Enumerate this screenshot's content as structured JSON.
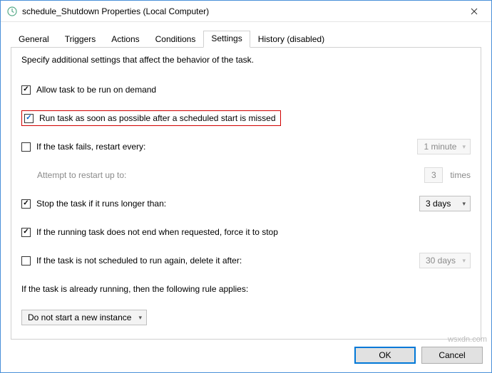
{
  "window": {
    "title": "schedule_Shutdown Properties (Local Computer)"
  },
  "tabs": {
    "general": "General",
    "triggers": "Triggers",
    "actions": "Actions",
    "conditions": "Conditions",
    "settings": "Settings",
    "history": "History (disabled)"
  },
  "settings": {
    "intro": "Specify additional settings that affect the behavior of the task.",
    "allow_on_demand": "Allow task to be run on demand",
    "run_asap": "Run task as soon as possible after a scheduled start is missed",
    "if_fails": "If the task fails, restart every:",
    "restart_interval": "1 minute",
    "attempt_label": "Attempt to restart up to:",
    "attempt_value": "3",
    "times_suffix": "times",
    "stop_if_longer": "Stop the task if it runs longer than:",
    "stop_duration": "3 days",
    "force_stop": "If the running task does not end when requested, force it to stop",
    "delete_after": "If the task is not scheduled to run again, delete it after:",
    "delete_duration": "30 days",
    "already_running": "If the task is already running, then the following rule applies:",
    "rule_value": "Do not start a new instance"
  },
  "buttons": {
    "ok": "OK",
    "cancel": "Cancel"
  },
  "watermark": "wsxdn.com"
}
